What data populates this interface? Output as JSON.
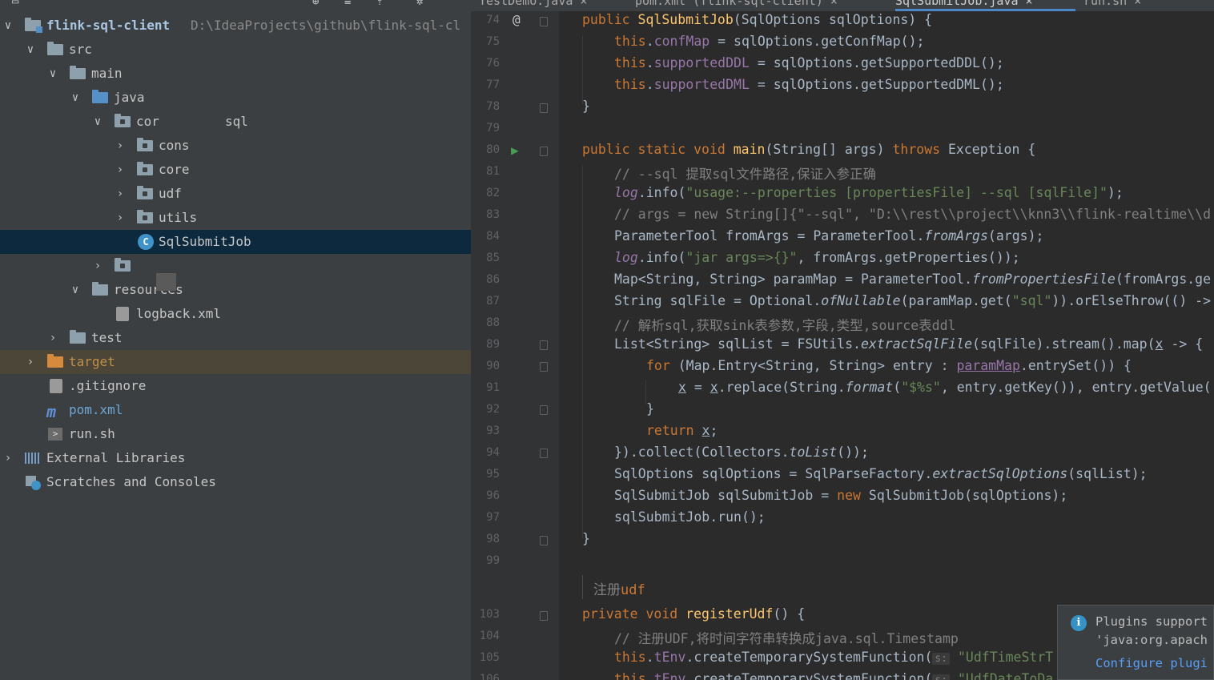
{
  "tree": {
    "topbar_icons": [
      "target-icon",
      "collapse-icon",
      "expand-icon",
      "gear-icon"
    ],
    "items": [
      {
        "label": "flink-sql-client",
        "path": "D:\\IdeaProjects\\github\\flink-sql-cl"
      },
      {
        "label": "src"
      },
      {
        "label": "main"
      },
      {
        "label": "java"
      },
      {
        "label": "cor",
        "extra": "sql"
      },
      {
        "label": "cons"
      },
      {
        "label": "core"
      },
      {
        "label": "udf"
      },
      {
        "label": "utils"
      },
      {
        "label": "SqlSubmitJob"
      },
      {
        "label": ""
      },
      {
        "label": "resources"
      },
      {
        "label": "logback.xml"
      },
      {
        "label": "test"
      },
      {
        "label": "target"
      },
      {
        "label": ".gitignore"
      },
      {
        "label": "pom.xml"
      },
      {
        "label": "run.sh"
      },
      {
        "label": "External Libraries"
      },
      {
        "label": "Scratches and Consoles"
      }
    ]
  },
  "tabs": [
    {
      "label": "TestDemo.java"
    },
    {
      "label": "pom.xml (flink-sql-client)"
    },
    {
      "label": "SqlSubmitJob.java"
    },
    {
      "label": "run.sh"
    }
  ],
  "gutter": {
    "line_numbers": [
      "74",
      "75",
      "76",
      "77",
      "78",
      "79",
      "80",
      "81",
      "82",
      "83",
      "84",
      "85",
      "86",
      "87",
      "88",
      "89",
      "90",
      "91",
      "92",
      "93",
      "94",
      "95",
      "96",
      "97",
      "98",
      "99",
      "103",
      "104",
      "105",
      "106"
    ]
  },
  "code": {
    "l74": [
      "public ",
      "SqlSubmitJob",
      "(SqlOptions sqlOptions) {"
    ],
    "l75": [
      "this",
      ".",
      "confMap",
      " = sqlOptions.getConfMap();"
    ],
    "l76": [
      "this",
      ".",
      "supportedDDL",
      " = sqlOptions.getSupportedDDL();"
    ],
    "l77": [
      "this",
      ".",
      "supportedDML",
      " = sqlOptions.getSupportedDML();"
    ],
    "l78": [
      "}"
    ],
    "l80": [
      "public static void ",
      "main",
      "(String[] args) ",
      "throws ",
      "Exception {"
    ],
    "l81": [
      "// --sql 提取sql文件路径,保证入参正确"
    ],
    "l82": [
      "log",
      ".info(",
      "\"usage:--properties [propertiesFile] --sql [sqlFile]\"",
      ");"
    ],
    "l83": [
      "// args = new String[]{\"--sql\", \"D:\\\\rest\\\\project\\\\knn3\\\\flink-realtime\\\\d"
    ],
    "l84": [
      "ParameterTool fromArgs = ParameterTool.",
      "fromArgs",
      "(args);"
    ],
    "l85": [
      "log",
      ".info(",
      "\"jar args=>{}\"",
      ", fromArgs.getProperties());"
    ],
    "l86": [
      "Map<String, String> paramMap = ParameterTool.",
      "fromPropertiesFile",
      "(fromArgs.ge"
    ],
    "l87": [
      "String sqlFile = Optional.",
      "ofNullable",
      "(paramMap.get(",
      "\"sql\"",
      ")).orElseThrow(() ->"
    ],
    "l88": [
      "// 解析sql,获取sink表参数,字段,类型,source表ddl"
    ],
    "l89": [
      "List<String> sqlList = FSUtils.",
      "extractSqlFile",
      "(sqlFile).stream().map(",
      "x",
      " -> {"
    ],
    "l90": [
      "for ",
      "(Map.Entry<String, String> entry : ",
      "paramMap",
      ".entrySet()) {"
    ],
    "l91": [
      "x",
      " = ",
      "x",
      ".replace(String.",
      "format",
      "(",
      "\"$%s\"",
      ", entry.getKey()), entry.getValue("
    ],
    "l92": [
      "}"
    ],
    "l93": [
      "return ",
      "x",
      ";"
    ],
    "l94": [
      "}).collect(Collectors.",
      "toList",
      "());"
    ],
    "l95": [
      "SqlOptions sqlOptions = SqlParseFactory.",
      "extractSqlOptions",
      "(sqlList);"
    ],
    "l96": [
      "SqlSubmitJob sqlSubmitJob = ",
      "new ",
      "SqlSubmitJob(sqlOptions);"
    ],
    "l97": [
      "sqlSubmitJob.run();"
    ],
    "l98": [
      "}"
    ],
    "doc": [
      "注册",
      "udf"
    ],
    "l103": [
      "private void ",
      "registerUdf",
      "() {"
    ],
    "l104": [
      "// 注册UDF,将时间字符串转换成java.sql.Timestamp"
    ],
    "l105": [
      "this",
      ".",
      "tEnv",
      ".createTemporarySystemFunction(",
      "s:",
      "\"UdfTimeStrT"
    ],
    "l106": [
      "this",
      ".",
      "tEnv",
      ".createTemporarySystemFunction(",
      "s:",
      "\"UdfDateToDa"
    ]
  },
  "notification": {
    "line1": "Plugins support",
    "line2": "'java:org.apach",
    "link": "Configure plugi"
  },
  "colors": {
    "keyword": "#cc7832",
    "function": "#ffc66d",
    "field": "#9876aa",
    "string": "#6a8759",
    "comment": "#808080",
    "selection": "#0d293e"
  }
}
